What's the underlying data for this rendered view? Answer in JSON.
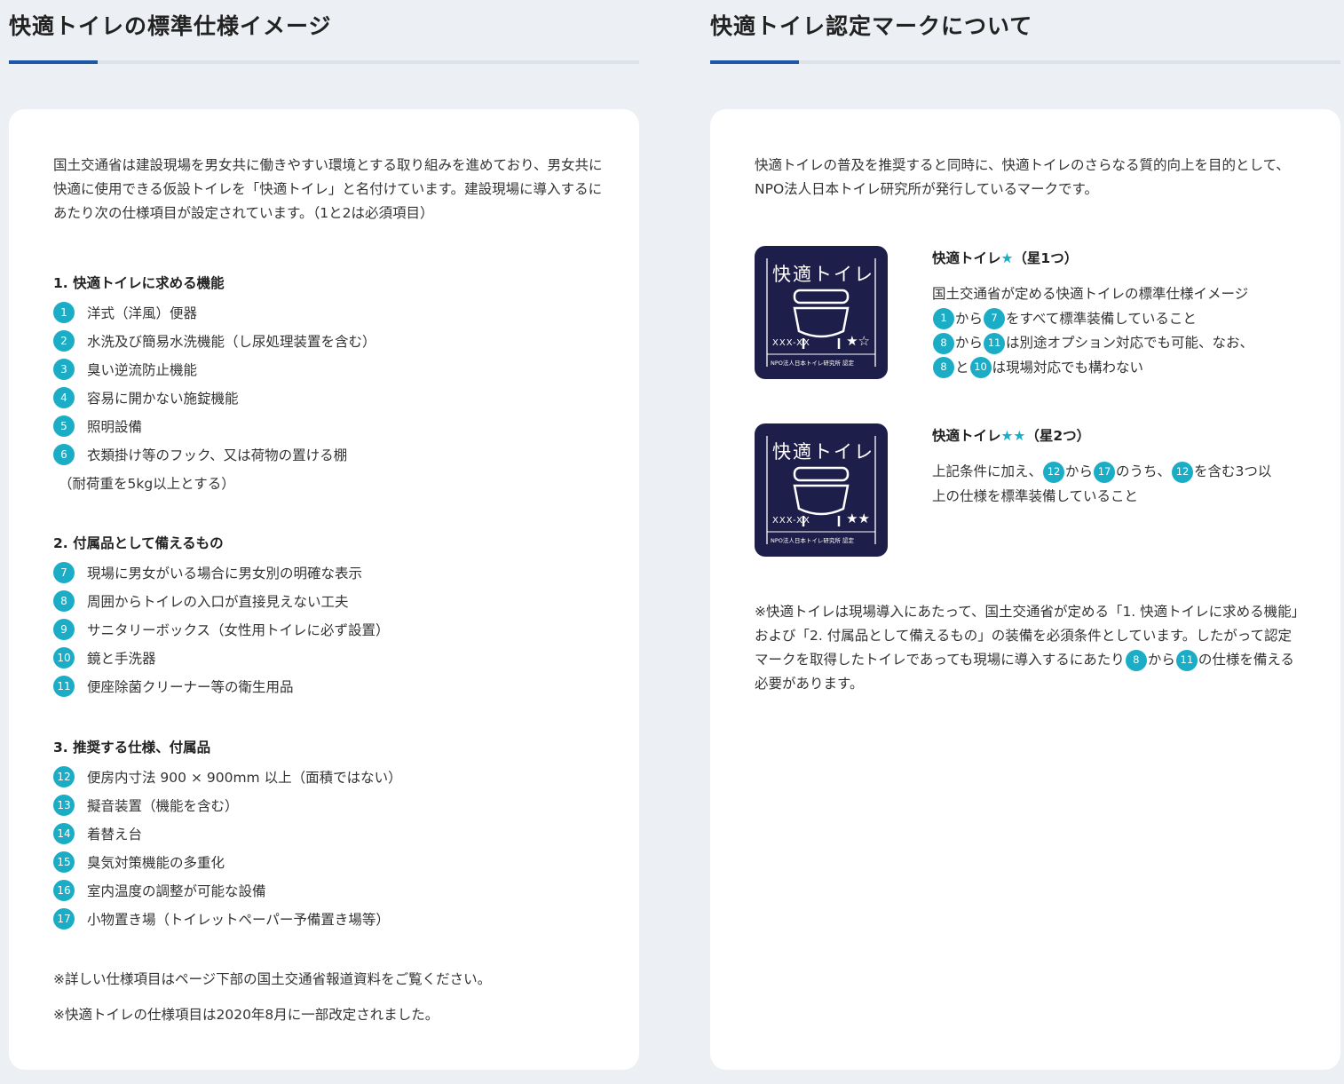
{
  "left": {
    "title": "快適トイレの標準仕様イメージ",
    "intro": "国土交通省は建設現場を男女共に働きやすい環境とする取り組みを進めており、男女共に快適に使用できる仮設トイレを「快適トイレ」と名付けています。建設現場に導入するにあたり次の仕様項目が設定されています。（1と2は必須項目）",
    "section1": {
      "heading": "1. 快適トイレに求める機能",
      "items": [
        {
          "num": "1",
          "label": "洋式（洋風）便器"
        },
        {
          "num": "2",
          "label": "水洗及び簡易水洗機能（し尿処理装置を含む）"
        },
        {
          "num": "3",
          "label": "臭い逆流防止機能"
        },
        {
          "num": "4",
          "label": "容易に開かない施錠機能"
        },
        {
          "num": "5",
          "label": "照明設備"
        },
        {
          "num": "6",
          "label": "衣類掛け等のフック、又は荷物の置ける棚"
        }
      ],
      "continuation": "（耐荷重を5kg以上とする）"
    },
    "section2": {
      "heading": "2. 付属品として備えるもの",
      "items": [
        {
          "num": "7",
          "label": "現場に男女がいる場合に男女別の明確な表示"
        },
        {
          "num": "8",
          "label": "周囲からトイレの入口が直接見えない工夫"
        },
        {
          "num": "9",
          "label": "サニタリーボックス（女性用トイレに必ず設置）"
        },
        {
          "num": "10",
          "label": "鏡と手洗器"
        },
        {
          "num": "11",
          "label": "便座除菌クリーナー等の衛生用品"
        }
      ]
    },
    "section3": {
      "heading": "3. 推奨する仕様、付属品",
      "items": [
        {
          "num": "12",
          "label": "便房内寸法 900 × 900mm 以上（面積ではない）"
        },
        {
          "num": "13",
          "label": "擬音装置（機能を含む）"
        },
        {
          "num": "14",
          "label": "着替え台"
        },
        {
          "num": "15",
          "label": "臭気対策機能の多重化"
        },
        {
          "num": "16",
          "label": "室内温度の調整が可能な設備"
        },
        {
          "num": "17",
          "label": "小物置き場（トイレットペーパー予備置き場等）"
        }
      ]
    },
    "note1": "※詳しい仕様項目はページ下部の国土交通省報道資料をご覧ください。",
    "note2": "※快適トイレの仕様項目は2020年8月に一部改定されました。"
  },
  "right": {
    "title": "快適トイレ認定マークについて",
    "intro": "快適トイレの普及を推奨すると同時に、快適トイレのさらなる質的向上を目的として、NPO法人日本トイレ研究所が発行しているマークです。",
    "mark1": {
      "badge_title": "快適トイレ",
      "badge_code": "XXX-XX",
      "badge_stars": "★☆",
      "badge_org": "NPO法人日本トイレ研究所 認定",
      "head_prefix": "快適トイレ",
      "head_stars": "★",
      "head_suffix": "（星1つ）",
      "line1": "国土交通省が定める快適トイレの標準仕様イメージ",
      "l2_a": "1",
      "l2_t1": "から",
      "l2_b": "7",
      "l2_t2": "をすべて標準装備していること",
      "l3_a": "8",
      "l3_t1": "から",
      "l3_b": "11",
      "l3_t2": "は別途オプション対応でも可能、なお、",
      "l4_a": "8",
      "l4_t1": "と",
      "l4_b": "10",
      "l4_t2": "は現場対応でも構わない"
    },
    "mark2": {
      "badge_title": "快適トイレ",
      "badge_code": "XXX-XX",
      "badge_stars": "★★",
      "badge_org": "NPO法人日本トイレ研究所 認定",
      "head_prefix": "快適トイレ",
      "head_stars": "★★",
      "head_suffix": "（星2つ）",
      "t0": "上記条件に加え、",
      "a": "12",
      "t1": "から",
      "b": "17",
      "t2": "のうち、",
      "c": "12",
      "t3": "を含む3つ以",
      "line2": "上の仕様を標準装備していること"
    },
    "note": {
      "p1": "※快適トイレは現場導入にあたって、国土交通省が定める「1. 快適トイレに求める機能」および「2. 付属品として備えるもの」の装備を必須条件としています。したがって認定マークを取得したトイレであっても現場に導入するにあたり",
      "n1": "8",
      "p2": "から",
      "n2": "11",
      "p3": "の仕様を備える必要があります。"
    }
  },
  "colors": {
    "accent_rule": "#1b57a4",
    "badge_number": "#1aadc5",
    "mark_background": "#1e1e4a"
  }
}
